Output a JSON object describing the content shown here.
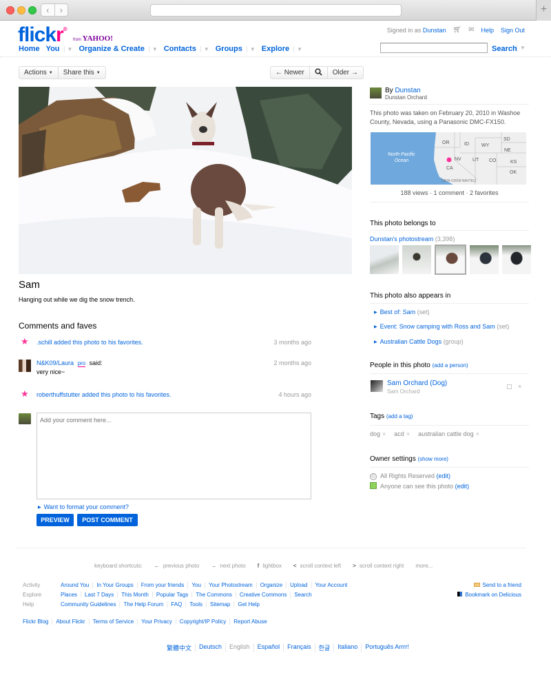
{
  "browser": {
    "back_label": "‹",
    "forward_label": "›",
    "new_tab_label": "+"
  },
  "header": {
    "logo_flick": "flick",
    "logo_r": "r",
    "logo_reg": "®",
    "from_label": "from",
    "yahoo_label": "YAHOO!",
    "signed_in_prefix": "Signed in as",
    "signed_in_user": "Dunstan",
    "help": "Help",
    "sign_out": "Sign Out",
    "nav": [
      {
        "label": "Home",
        "has_menu": false
      },
      {
        "label": "You",
        "has_menu": true
      },
      {
        "label": "Organize & Create",
        "has_menu": true
      },
      {
        "label": "Contacts",
        "has_menu": true
      },
      {
        "label": "Groups",
        "has_menu": true
      },
      {
        "label": "Explore",
        "has_menu": true
      }
    ],
    "search_value": "",
    "search_label": "Search"
  },
  "toolbar": {
    "actions": "Actions",
    "share": "Share this",
    "newer": "← Newer",
    "older": "Older →"
  },
  "photo": {
    "title": "Sam",
    "description": "Hanging out while we dig the snow trench."
  },
  "comments": {
    "heading": "Comments and faves",
    "items": [
      {
        "type": "fave",
        "text": ".schill added this photo to his favorites.",
        "time": "3 months ago"
      },
      {
        "type": "comment",
        "user": "N&K09/Laura",
        "badge": "pro",
        "said": "said:",
        "body": "very nice~",
        "time": "2 months ago"
      },
      {
        "type": "fave",
        "text": "roberthuffstutter added this photo to his favorites.",
        "time": "4 hours ago"
      }
    ],
    "placeholder": "Add your comment here...",
    "format_link": "Want to format your comment?",
    "preview_btn": "PREVIEW",
    "post_btn": "POST COMMENT"
  },
  "sidebar": {
    "by_label": "By",
    "owner": "Dunstan",
    "owner_fullname": "Dunstan Orchard",
    "taken_info": "This photo was taken on February 20, 2010 in Washoe County, Nevada, using a Panasonic DMC-FX150.",
    "map": {
      "ocean_label_1": "North Pacific",
      "ocean_label_2": "Ocean",
      "states": [
        "OR",
        "ID",
        "WY",
        "SD",
        "NE",
        "NV",
        "UT",
        "CO",
        "KS",
        "CA",
        "OK"
      ],
      "credit": "DATA ©2009 NAVTEQ",
      "ocean_color": "#6fa8dc",
      "land_color": "#efefef",
      "marker_color": "#ff3399"
    },
    "stats": "188 views · 1 comment · 2 favorites",
    "belongs_heading": "This photo belongs to",
    "photostream_link": "Dunstan's photostream",
    "photostream_count": "(3,398)",
    "appears_heading": "This photo also appears in",
    "appears": [
      {
        "name": "Best of: Sam",
        "kind": "(set)"
      },
      {
        "name": "Event: Snow camping with Ross and Sam",
        "kind": "(set)"
      },
      {
        "name": "Australian Cattle Dogs",
        "kind": "(group)"
      }
    ],
    "people_heading": "People in this photo",
    "add_person": "(add a person)",
    "person_name": "Sam Orchard (Dog)",
    "person_sub": "Sam Orchard",
    "person_remove": "×",
    "tags_heading": "Tags",
    "add_tag": "(add a tag)",
    "tags": [
      "dog",
      "acd",
      "australian cattle dog"
    ],
    "tag_remove": "×",
    "owner_heading": "Owner settings",
    "show_more": "(show more)",
    "license": "All Rights Reserved",
    "visibility": "Anyone can see this photo",
    "edit": "(edit)"
  },
  "footer": {
    "shortcuts_label": "keyboard shortcuts:",
    "shortcuts": [
      {
        "key": "←",
        "label": "previous photo"
      },
      {
        "key": "→",
        "label": "next photo"
      },
      {
        "key": "f",
        "label": "lightbox"
      },
      {
        "key": "<",
        "label": "scroll context left"
      },
      {
        "key": ">",
        "label": "scroll context right"
      }
    ],
    "more": "more...",
    "rows": [
      {
        "label": "Activity",
        "links": [
          "Around You",
          "In Your Groups",
          "From your friends",
          "You",
          "Your Photostream",
          "Organize",
          "Upload",
          "Your Account"
        ]
      },
      {
        "label": "Explore",
        "links": [
          "Places",
          "Last 7 Days",
          "This Month",
          "Popular Tags",
          "The Commons",
          "Creative Commons",
          "Search"
        ]
      },
      {
        "label": "Help",
        "links": [
          "Community Guidelines",
          "The Help Forum",
          "FAQ",
          "Tools",
          "Sitemap",
          "Get Help"
        ]
      }
    ],
    "bottom_links": [
      "Flickr Blog",
      "About Flickr",
      "Terms of Service",
      "Your Privacy",
      "Copyright/IP Policy",
      "Report Abuse"
    ],
    "send_friend": "Send to a friend",
    "bookmark": "Bookmark on Delicious",
    "languages": [
      "繁體中文",
      "Deutsch",
      "English",
      "Español",
      "Français",
      "한글",
      "Italiano",
      "Português Arrrr!"
    ],
    "current_language": "English"
  }
}
